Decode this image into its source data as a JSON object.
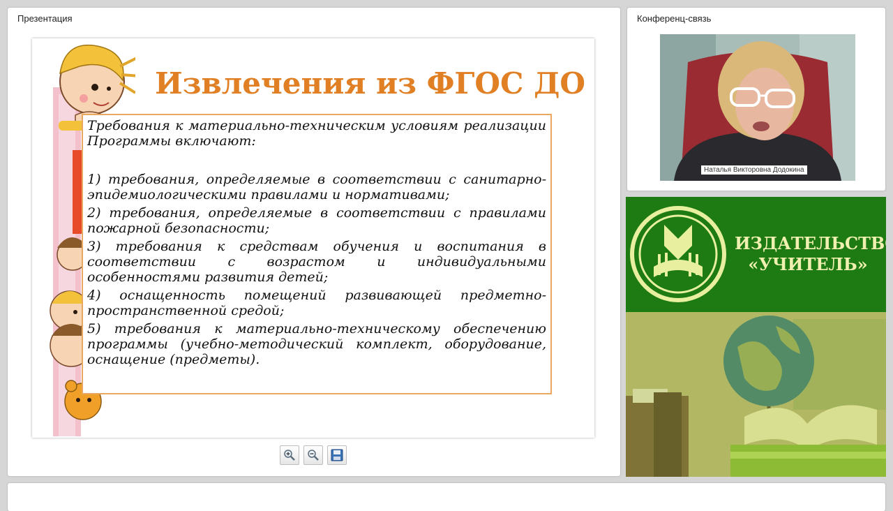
{
  "presentation_panel": {
    "title": "Презентация"
  },
  "slide": {
    "title": "Извлечения из ФГОС ДО",
    "intro": "Требования к материально-техническим условиям реализации Программы включают:",
    "items": [
      "1) требования, определяемые в соответствии с санитарно-эпидемиологическими правилами и нормативами;",
      "2) требования, определяемые в соответствии с правилами пожарной безопасности;",
      "3) требования к средствам обучения и воспитания в соответствии с возрастом и индивидуальными особенностями развития детей;",
      "4) оснащенность помещений развивающей предметно-пространственной средой;",
      "5) требования к материально-техническому обеспечению программы (учебно-методический комплект, оборудование, оснащение (предметы)."
    ],
    "accent_color": "#e07f23"
  },
  "toolbar": {
    "buttons": [
      {
        "icon": "zoom-in-icon"
      },
      {
        "icon": "zoom-out-icon"
      },
      {
        "icon": "save-icon"
      }
    ]
  },
  "conference_panel": {
    "title": "Конференц-связь",
    "participant_name": "Наталья Викторовна Додокина"
  },
  "publisher": {
    "name_line1": "ИЗДАТЕЛЬСТВО",
    "name_line2": "«УЧИТЕЛЬ»",
    "brand_color": "#1e7a12"
  }
}
